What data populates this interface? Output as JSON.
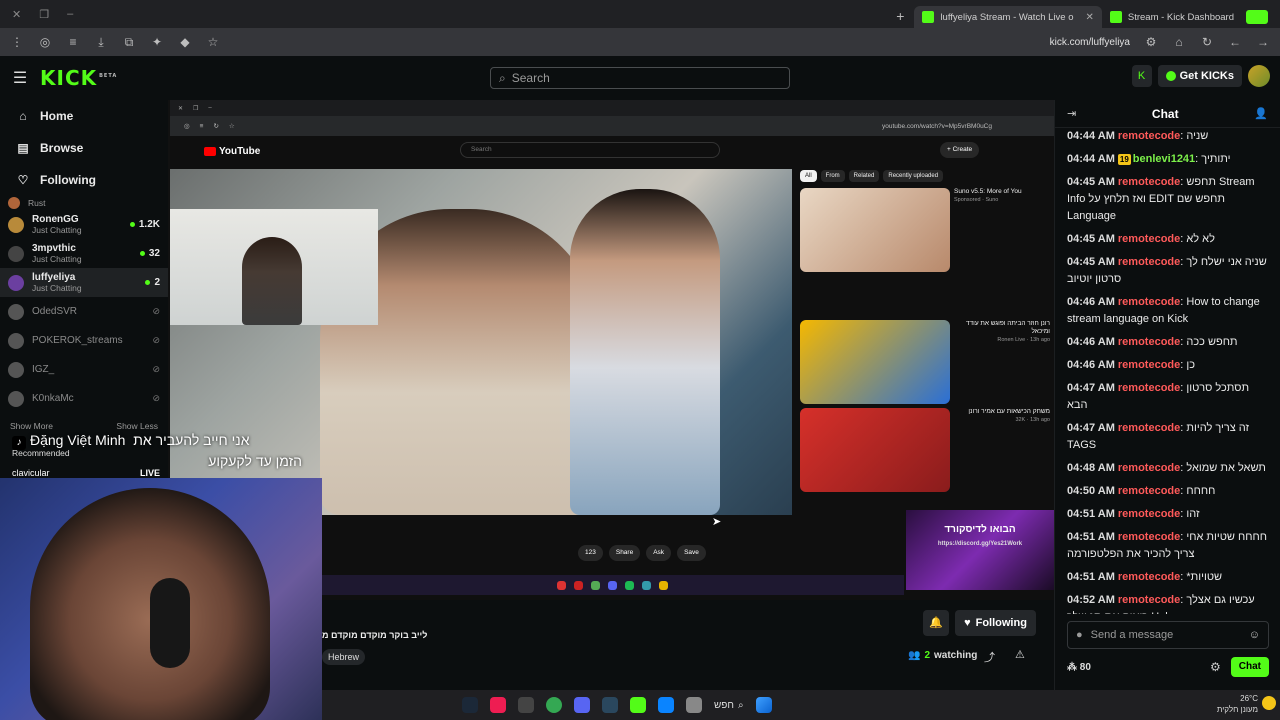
{
  "browser": {
    "tabs": [
      {
        "label": "luffyeliya Stream - Watch Live o",
        "active": true
      },
      {
        "label": "Stream - Kick Dashboard",
        "active": false
      }
    ],
    "url": "kick.com/luffyeliya"
  },
  "header": {
    "logo": "KICK",
    "logo_badge": "BETA",
    "search_placeholder": "Search",
    "get_kicks": "Get KICKs"
  },
  "sidebar": {
    "nav": [
      {
        "label": "Home",
        "icon": "home-icon"
      },
      {
        "label": "Browse",
        "icon": "browse-icon"
      },
      {
        "label": "Following",
        "icon": "heart-icon"
      }
    ],
    "channels": [
      {
        "name": "RonenGG",
        "sub": "Just Chatting",
        "viewers": "1.2K",
        "live": true
      },
      {
        "name": "3mpvthic",
        "sub": "Just Chatting",
        "viewers": "32",
        "live": true
      },
      {
        "name": "luffyeliya",
        "sub": "Just Chatting",
        "viewers": "2",
        "live": true
      },
      {
        "name": "OdedSVR",
        "live": false
      },
      {
        "name": "POKEROK_streams",
        "live": false
      },
      {
        "name": "IGZ_",
        "live": false
      },
      {
        "name": "K0nkaMc",
        "live": false
      }
    ],
    "partial_top": "Rust",
    "show_more": "Show More",
    "show_less": "Show Less",
    "recommended": "Recommended",
    "rec_channel": "clavicular",
    "rec_live": "LIVE"
  },
  "overlay": {
    "name": "Đặng Việt Minh",
    "line1": "אני חייב להעביר את",
    "line2": "הזמן עד לקעקוע"
  },
  "embedded": {
    "yt_search": "Search",
    "yt_create": "Create",
    "url": "youtube.com/watch?v=Mp5vrBM0uCg",
    "yt_logo": "YouTube",
    "chips": [
      "All",
      "From",
      "Related",
      "Recently uploaded"
    ],
    "actions": [
      "123",
      "Share",
      "Ask",
      "Save"
    ],
    "related": [
      {
        "title": "Suno v5.5: More of You",
        "sub": "Sponsored · Suno"
      },
      {
        "title": "רונן חוזר הביתה ופוגש את עודד ומיכאל",
        "sub": "Ronen Live · 13h ago"
      },
      {
        "title": "משחק הכישאות עם אמיר ורונן",
        "sub": "32K · 13h ago"
      }
    ],
    "promo_line": "הבואו לדיסקורד",
    "promo_link": "https://discord.gg/Yes21Work"
  },
  "stream": {
    "title": "לייב בוקר מוקדם מוקדם מ",
    "tag": "Hebrew",
    "following": "Following",
    "watching_count": "2",
    "watching_label": "watching"
  },
  "taskbar": {
    "search": "חפש",
    "temp": "26°C",
    "weather": "מעונן חלקית"
  },
  "chat": {
    "title": "Chat",
    "placeholder": "Send a message",
    "points": "80",
    "send": "Chat",
    "messages": [
      {
        "time": "04:44 AM",
        "user": "remotecode",
        "text": "שניה"
      },
      {
        "time": "04:44 AM",
        "user": "benlevi1241",
        "text": "יתותיך",
        "badge": "19",
        "green": true
      },
      {
        "time": "04:45 AM",
        "user": "remotecode",
        "text": "תחפש Stream Info ואז תלחץ על EDIT תחפש שם Language"
      },
      {
        "time": "04:45 AM",
        "user": "remotecode",
        "text": "לא לא"
      },
      {
        "time": "04:45 AM",
        "user": "remotecode",
        "text": "שניה אני ישלח לך סרטון יוטיוב"
      },
      {
        "time": "04:46 AM",
        "user": "remotecode",
        "text": "How to change stream language on Kick"
      },
      {
        "time": "04:46 AM",
        "user": "remotecode",
        "text": "תחפש ככה"
      },
      {
        "time": "04:46 AM",
        "user": "remotecode",
        "text": "כן"
      },
      {
        "time": "04:47 AM",
        "user": "remotecode",
        "text": "תסתכל סרטון הבא"
      },
      {
        "time": "04:47 AM",
        "user": "remotecode",
        "text": "זה צריך להיות TAGS"
      },
      {
        "time": "04:48 AM",
        "user": "remotecode",
        "text": "תשאל את שמואל"
      },
      {
        "time": "04:50 AM",
        "user": "remotecode",
        "text": "חחחח"
      },
      {
        "time": "04:51 AM",
        "user": "remotecode",
        "text": "זהו"
      },
      {
        "time": "04:51 AM",
        "user": "remotecode",
        "text": "חחחח שטיות אחי צריך להכיר את הפלטפורמה"
      },
      {
        "time": "04:51 AM",
        "user": "remotecode",
        "text": "*שטויות"
      },
      {
        "time": "04:52 AM",
        "user": "remotecode",
        "text": "עכשיו גם אצלך רואים את תג שלך Hebrew"
      }
    ]
  }
}
